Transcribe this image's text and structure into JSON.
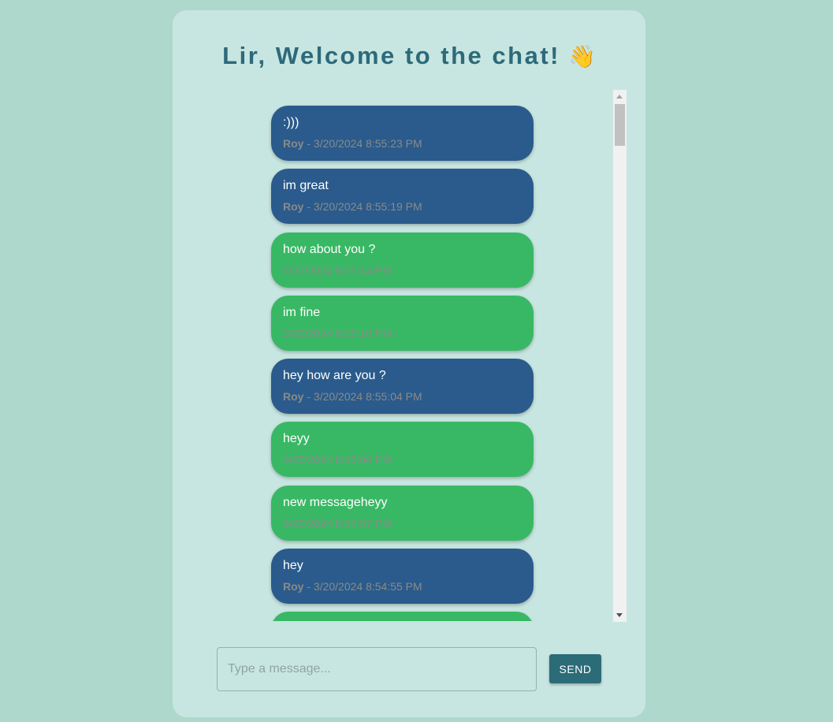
{
  "header": {
    "title": "Lir, Welcome to the chat!",
    "emoji": "👋"
  },
  "messages": [
    {
      "text": ":)))",
      "sender": "Roy",
      "separator": " - ",
      "timestamp": "3/20/2024 8:55:23 PM",
      "color": "#2a5b8c"
    },
    {
      "text": "im great",
      "sender": "Roy",
      "separator": " - ",
      "timestamp": "3/20/2024 8:55:19 PM",
      "color": "#2a5b8c"
    },
    {
      "text": "how about you ?",
      "sender": "",
      "separator": "",
      "timestamp": "3/20/2024 8:55:14 PM",
      "color": "#38b864"
    },
    {
      "text": "im fine",
      "sender": "",
      "separator": "",
      "timestamp": "3/20/2024 8:55:10 PM",
      "color": "#38b864"
    },
    {
      "text": "hey how are you ?",
      "sender": "Roy",
      "separator": " - ",
      "timestamp": "3/20/2024 8:55:04 PM",
      "color": "#2a5b8c"
    },
    {
      "text": "heyy",
      "sender": "",
      "separator": "",
      "timestamp": "3/20/2024 8:55:00 PM",
      "color": "#38b864"
    },
    {
      "text": "new messageheyy",
      "sender": "",
      "separator": "",
      "timestamp": "3/20/2024 8:54:57 PM",
      "color": "#38b864"
    },
    {
      "text": "hey",
      "sender": "Roy",
      "separator": " - ",
      "timestamp": "3/20/2024 8:54:55 PM",
      "color": "#2a5b8c"
    },
    {
      "text": "",
      "sender": "",
      "separator": "",
      "timestamp": "",
      "color": "#38b864"
    }
  ],
  "composer": {
    "placeholder": "Type a message...",
    "value": ""
  },
  "send_button": {
    "label": "SEND"
  },
  "colors": {
    "background": "#aed8cc",
    "card": "#c8e6e1",
    "title": "#2d6a7a",
    "own_message": "#38b864",
    "other_message": "#2a5b8c",
    "send_button": "#2c6b78"
  }
}
